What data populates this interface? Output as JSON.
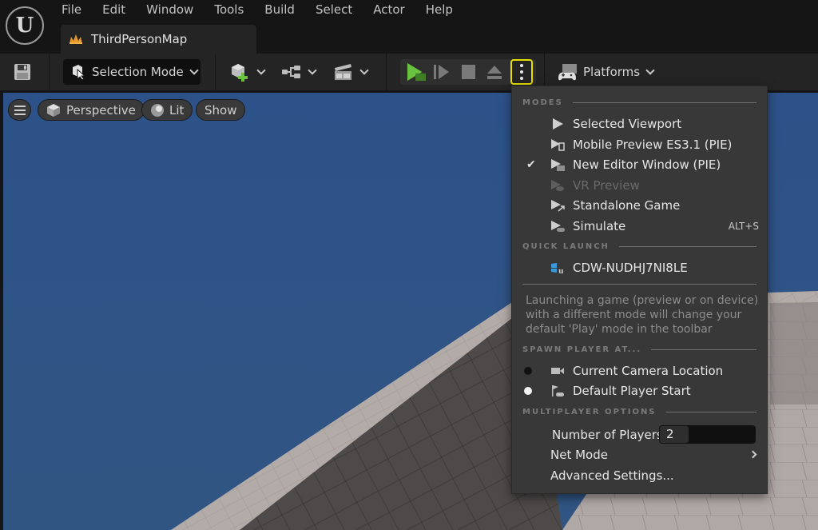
{
  "app": {
    "logo_glyph": "U"
  },
  "menubar": {
    "items": [
      "File",
      "Edit",
      "Window",
      "Tools",
      "Build",
      "Select",
      "Actor",
      "Help"
    ]
  },
  "tab": {
    "label": "ThirdPersonMap",
    "icon": "level-map-icon",
    "icon_color": "#e89a2c"
  },
  "toolbar": {
    "selection_mode_label": "Selection Mode",
    "platforms_label": "Platforms",
    "play_color": "#6ac33e",
    "highlight_color": "#e8e000"
  },
  "viewport": {
    "menu_icon": "hamburger-icon",
    "perspective_label": "Perspective",
    "lit_label": "Lit",
    "show_label": "Show",
    "sky_color": "#2f5384"
  },
  "dropdown": {
    "modes_header": "MODES",
    "modes": [
      {
        "label": "Selected Viewport",
        "icon": "play-icon",
        "checked": false,
        "disabled": false,
        "shortcut": ""
      },
      {
        "label": "Mobile Preview ES3.1 (PIE)",
        "icon": "mobile-preview-icon",
        "checked": false,
        "disabled": false,
        "shortcut": ""
      },
      {
        "label": "New Editor Window (PIE)",
        "icon": "new-window-icon",
        "checked": true,
        "disabled": false,
        "shortcut": ""
      },
      {
        "label": "VR Preview",
        "icon": "vr-preview-icon",
        "checked": false,
        "disabled": true,
        "shortcut": ""
      },
      {
        "label": "Standalone Game",
        "icon": "standalone-icon",
        "checked": false,
        "disabled": false,
        "shortcut": ""
      },
      {
        "label": "Simulate",
        "icon": "simulate-icon",
        "checked": false,
        "disabled": false,
        "shortcut": "ALT+S"
      }
    ],
    "check_glyph": "✔",
    "quick_launch_header": "QUICK LAUNCH",
    "quick_launch": [
      {
        "label": "CDW-NUDHJ7NI8LE",
        "icon": "windows-device-icon"
      }
    ],
    "note": "Launching a game (preview or on device) with a different mode will change your default 'Play' mode in the toolbar",
    "spawn_header": "SPAWN PLAYER AT...",
    "spawn_options": [
      {
        "label": "Current Camera Location",
        "icon": "camera-icon",
        "selected": false
      },
      {
        "label": "Default Player Start",
        "icon": "player-start-icon",
        "selected": true
      }
    ],
    "multiplayer_header": "MULTIPLAYER OPTIONS",
    "number_of_players_label": "Number of Players",
    "number_of_players_value": "2",
    "net_mode_label": "Net Mode",
    "advanced_settings_label": "Advanced Settings..."
  }
}
